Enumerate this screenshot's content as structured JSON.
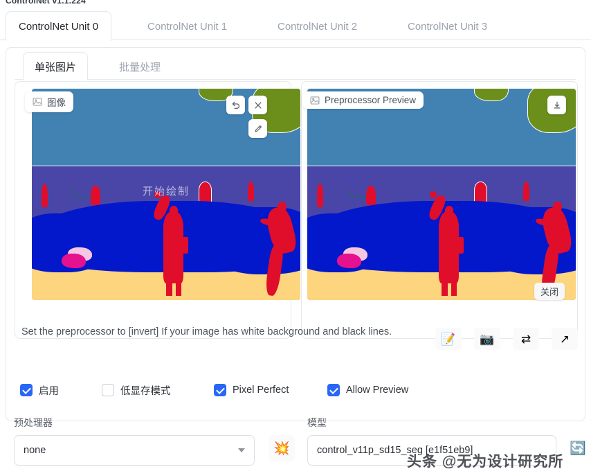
{
  "app": {
    "title": "ControlNet v1.1.224"
  },
  "tabs": [
    {
      "label": "ControlNet Unit 0",
      "active": true
    },
    {
      "label": "ControlNet Unit 1",
      "active": false
    },
    {
      "label": "ControlNet Unit 2",
      "active": false
    },
    {
      "label": "ControlNet Unit 3",
      "active": false
    }
  ],
  "subtabs": [
    {
      "label": "单张图片",
      "active": true
    },
    {
      "label": "批量处理",
      "active": false
    }
  ],
  "image_panel": {
    "label": "图像",
    "label_icon": "image-icon",
    "draw_overlay_text": "开始绘制",
    "tools": {
      "undo": "↺",
      "close": "✕",
      "brush": "✎"
    }
  },
  "preview_panel": {
    "label": "Preprocessor Preview",
    "label_icon": "image-icon",
    "download": "⤓",
    "close_label": "关闭"
  },
  "hint": {
    "text": "Set the preprocessor to [invert] If your image has white background and black lines."
  },
  "icon_buttons": [
    {
      "name": "paste-prompt-icon",
      "glyph": "📝"
    },
    {
      "name": "camera-icon",
      "glyph": "📷"
    },
    {
      "name": "swap-icon",
      "glyph": "⇄"
    },
    {
      "name": "send-icon",
      "glyph": "↗"
    }
  ],
  "checkboxes": [
    {
      "label": "启用",
      "checked": true
    },
    {
      "label": "低显存模式",
      "checked": false
    },
    {
      "label": "Pixel Perfect",
      "checked": true
    },
    {
      "label": "Allow Preview",
      "checked": true
    }
  ],
  "preprocessor": {
    "label": "预处理器",
    "value": "none",
    "run_icon": "💥"
  },
  "model": {
    "label": "模型",
    "value": "control_v11p_sd15_seg [e1f51eb9]",
    "refresh_icon": "🔄"
  },
  "watermark": {
    "text": "头条 @无为设计研究所"
  },
  "colors": {
    "accent": "#2867f5",
    "sky": "#4282b3",
    "sea": "#4a46a8",
    "sand": "#fcd57e",
    "rock": "#0418cb",
    "person": "#e00e2b",
    "vegetation": "#6c8f1c",
    "umbrella": "#e5118f"
  }
}
